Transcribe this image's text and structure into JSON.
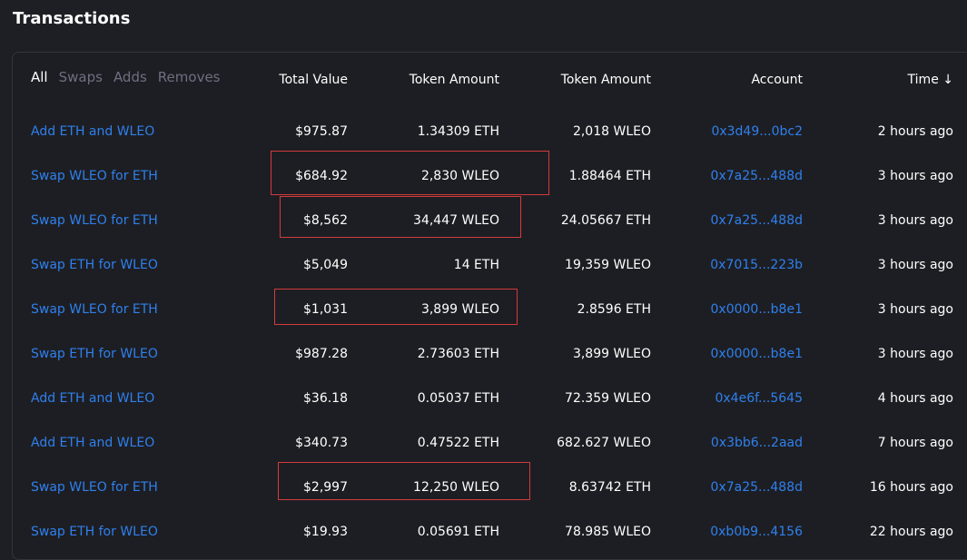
{
  "page": {
    "title": "Transactions"
  },
  "filters": [
    {
      "label": "All",
      "active": true
    },
    {
      "label": "Swaps",
      "active": false
    },
    {
      "label": "Adds",
      "active": false
    },
    {
      "label": "Removes",
      "active": false
    }
  ],
  "table": {
    "headers": {
      "total_value": "Total Value",
      "token_amount_1": "Token Amount",
      "token_amount_2": "Token Amount",
      "account": "Account",
      "time": "Time ↓"
    },
    "rows": [
      {
        "action": "Add ETH and WLEO",
        "total": "$975.87",
        "amount1": "1.34309 ETH",
        "amount2": "2,018 WLEO",
        "account": "0x3d49...0bc2",
        "time": "2 hours ago"
      },
      {
        "action": "Swap WLEO for ETH",
        "total": "$684.92",
        "amount1": "2,830 WLEO",
        "amount2": "1.88464 ETH",
        "account": "0x7a25...488d",
        "time": "3 hours ago"
      },
      {
        "action": "Swap WLEO for ETH",
        "total": "$8,562",
        "amount1": "34,447 WLEO",
        "amount2": "24.05667 ETH",
        "account": "0x7a25...488d",
        "time": "3 hours ago"
      },
      {
        "action": "Swap ETH for WLEO",
        "total": "$5,049",
        "amount1": "14 ETH",
        "amount2": "19,359 WLEO",
        "account": "0x7015...223b",
        "time": "3 hours ago"
      },
      {
        "action": "Swap WLEO for ETH",
        "total": "$1,031",
        "amount1": "3,899 WLEO",
        "amount2": "2.8596 ETH",
        "account": "0x0000...b8e1",
        "time": "3 hours ago"
      },
      {
        "action": "Swap ETH for WLEO",
        "total": "$987.28",
        "amount1": "2.73603 ETH",
        "amount2": "3,899 WLEO",
        "account": "0x0000...b8e1",
        "time": "3 hours ago"
      },
      {
        "action": "Add ETH and WLEO",
        "total": "$36.18",
        "amount1": "0.05037 ETH",
        "amount2": "72.359 WLEO",
        "account": "0x4e6f...5645",
        "time": "4 hours ago"
      },
      {
        "action": "Add ETH and WLEO",
        "total": "$340.73",
        "amount1": "0.47522 ETH",
        "amount2": "682.627 WLEO",
        "account": "0x3bb6...2aad",
        "time": "7 hours ago"
      },
      {
        "action": "Swap WLEO for ETH",
        "total": "$2,997",
        "amount1": "12,250 WLEO",
        "amount2": "8.63742 ETH",
        "account": "0x7a25...488d",
        "time": "16 hours ago"
      },
      {
        "action": "Swap ETH for WLEO",
        "total": "$19.93",
        "amount1": "0.05691 ETH",
        "amount2": "78.985 WLEO",
        "account": "0xb0b9...4156",
        "time": "22 hours ago"
      }
    ]
  },
  "colors": {
    "link": "#2f80ed",
    "highlight": "#d23b3b",
    "background": "#1e1f24"
  }
}
